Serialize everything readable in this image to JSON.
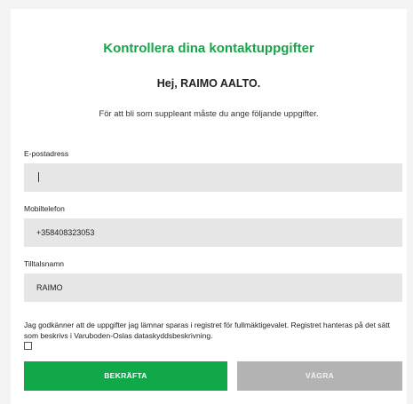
{
  "header": {
    "title": "Kontrollera dina kontaktuppgifter",
    "greeting": "Hej, RAIMO AALTO.",
    "intro": "För att bli som suppleant måste du ange följande uppgifter."
  },
  "form": {
    "email": {
      "label": "E-postadress",
      "value": ""
    },
    "phone": {
      "label": "Mobiltelefon",
      "value": "+358408323053"
    },
    "nickname": {
      "label": "Tilltalsnamn",
      "value": "RAIMO"
    },
    "consent": {
      "text": "Jag godkänner att de uppgifter jag lämnar sparas i registret för fullmäktigevalet. Registret hanteras på det sätt som beskrivs i Varuboden-Oslas dataskyddsbeskrivning.",
      "checked": false
    }
  },
  "actions": {
    "confirm_label": "BEKRÄFTA",
    "refuse_label": "VÄGRA"
  },
  "colors": {
    "accent": "#19a34a",
    "confirm_button": "#11a84a",
    "refuse_button": "#b3b3b3",
    "field_background": "#e6e6e6"
  }
}
